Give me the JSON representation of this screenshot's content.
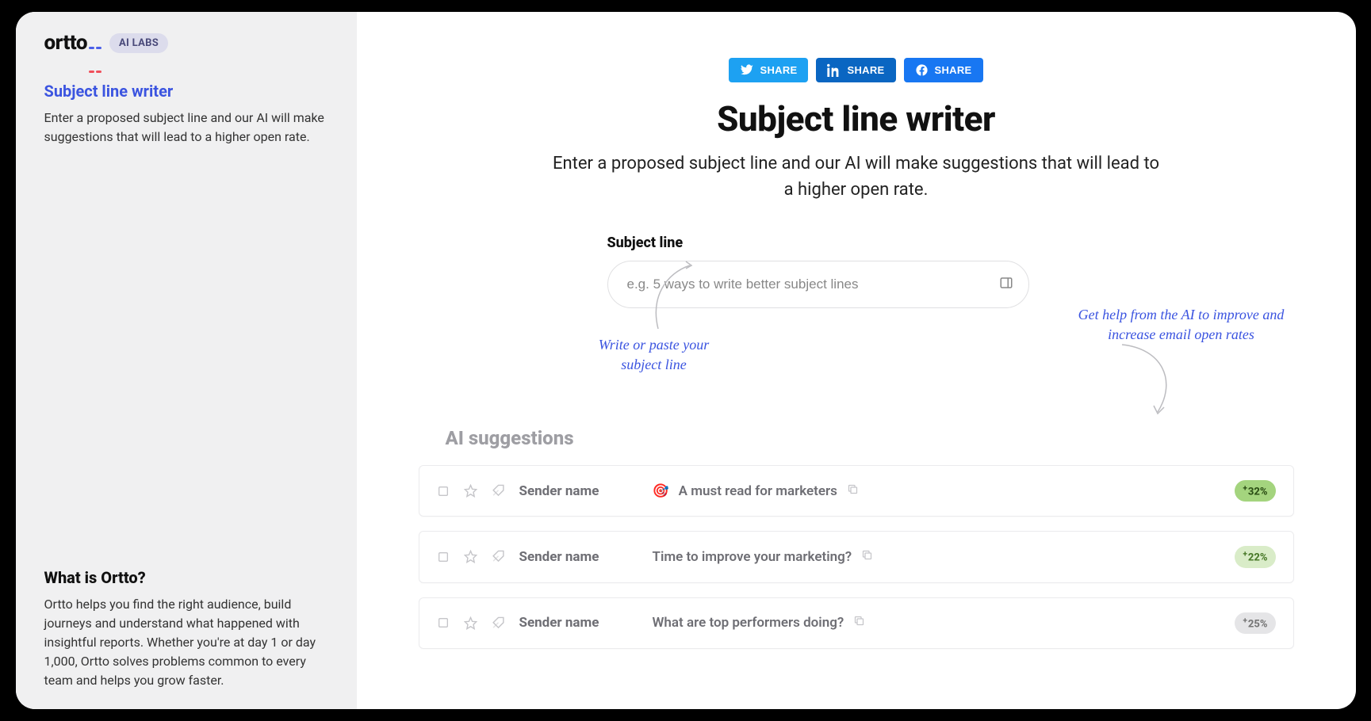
{
  "brand": {
    "name": "ortto",
    "badge": "AI LABS"
  },
  "sidebar": {
    "title": "Subject line writer",
    "desc": "Enter a proposed subject line and our AI will make suggestions that will lead to a higher open rate.",
    "whatIsTitle": "What is Ortto?",
    "whatIsText": "Ortto helps you find the right audience, build journeys and understand what happened with insightful reports. Whether you're at day 1 or day 1,000, Ortto solves problems common to every team and helps you grow faster."
  },
  "share": {
    "twitter": {
      "label": "SHARE",
      "color": "#1da1f2"
    },
    "linkedin": {
      "label": "SHARE",
      "color": "#0a66c2"
    },
    "facebook": {
      "label": "SHARE",
      "color": "#1877f2"
    }
  },
  "main": {
    "title": "Subject line writer",
    "desc": "Enter a proposed subject line and our AI will make suggestions that will lead to a higher open rate.",
    "inputLabel": "Subject line",
    "inputPlaceholder": "e.g. 5 ways to write better subject lines",
    "hintLeft": "Write or paste your subject line",
    "hintRight": "Get help from the AI to improve and increase email open rates",
    "suggestionsTitle": "AI suggestions"
  },
  "suggestions": [
    {
      "sender": "Sender name",
      "emoji": "🎯",
      "subject": "A must read for marketers",
      "badge": "32%",
      "badgeClass": "badge-green-strong"
    },
    {
      "sender": "Sender name",
      "emoji": "",
      "subject": "Time to improve your marketing?",
      "badge": "22%",
      "badgeClass": "badge-green-light"
    },
    {
      "sender": "Sender name",
      "emoji": "",
      "subject": "What are top performers doing?",
      "badge": "25%",
      "badgeClass": "badge-grey"
    }
  ]
}
